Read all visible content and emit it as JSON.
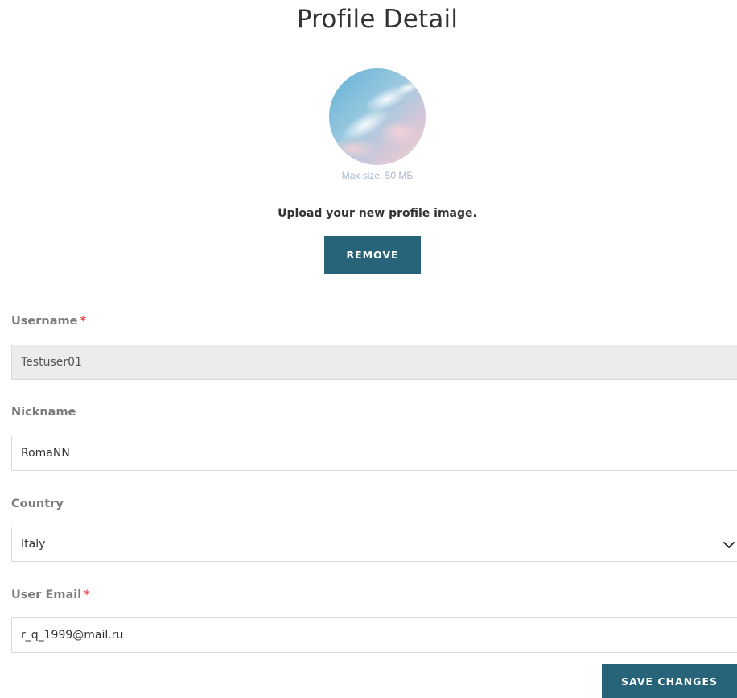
{
  "page": {
    "title": "Profile Detail"
  },
  "avatar": {
    "max_size_text": "Max size: 50 МБ",
    "upload_text": "Upload your new profile image.",
    "remove_label": "REMOVE"
  },
  "form": {
    "username": {
      "label": "Username",
      "required_mark": "*",
      "value": "Testuser01"
    },
    "nickname": {
      "label": "Nickname",
      "value": "RomaNN"
    },
    "country": {
      "label": "Country",
      "selected": "Italy"
    },
    "email": {
      "label": "User Email",
      "required_mark": "*",
      "value": "r_q_1999@mail.ru"
    }
  },
  "actions": {
    "save_label": "SAVE CHANGES"
  },
  "colors": {
    "primary": "#276479",
    "required": "#e5484d",
    "label": "#7b7b7b",
    "hint": "#a7b8cc"
  }
}
